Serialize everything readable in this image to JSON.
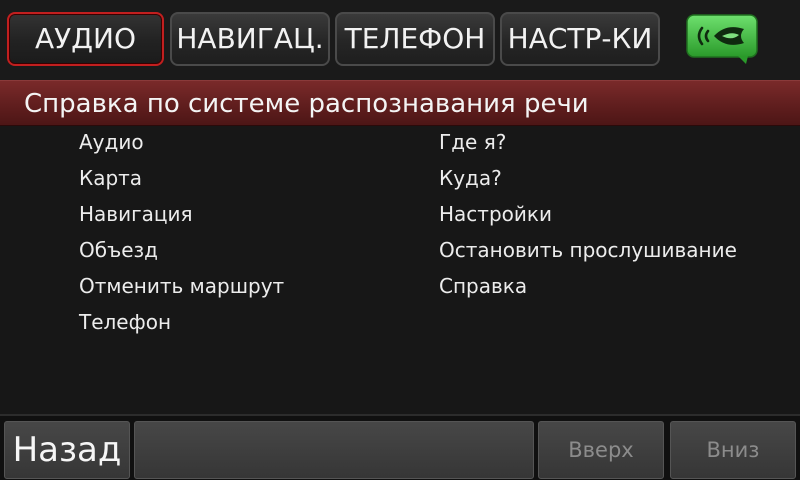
{
  "tabs": [
    {
      "label": "АУДИО",
      "active": true
    },
    {
      "label": "НАВИГАЦ.",
      "active": false
    },
    {
      "label": "ТЕЛЕФОН",
      "active": false
    },
    {
      "label": "НАСТР-КИ",
      "active": false
    }
  ],
  "voice_button": {
    "icon": "voice-recognition-icon",
    "color": "#3bbf3b"
  },
  "header": {
    "title": "Справка по системе распознавания речи"
  },
  "commands_left": [
    "Аудио",
    "Карта",
    "Навигация",
    "Объезд",
    "Отменить маршрут",
    "Телефон"
  ],
  "commands_right": [
    "Где я?",
    "Куда?",
    "Настройки",
    "Остановить прослушивание",
    "Справка"
  ],
  "bottom": {
    "back_label": "Назад",
    "up_label": "Вверх",
    "down_label": "Вниз"
  },
  "colors": {
    "accent_red": "#c21f1f",
    "header_red": "#6a2222",
    "voice_green": "#3bbf3b"
  }
}
